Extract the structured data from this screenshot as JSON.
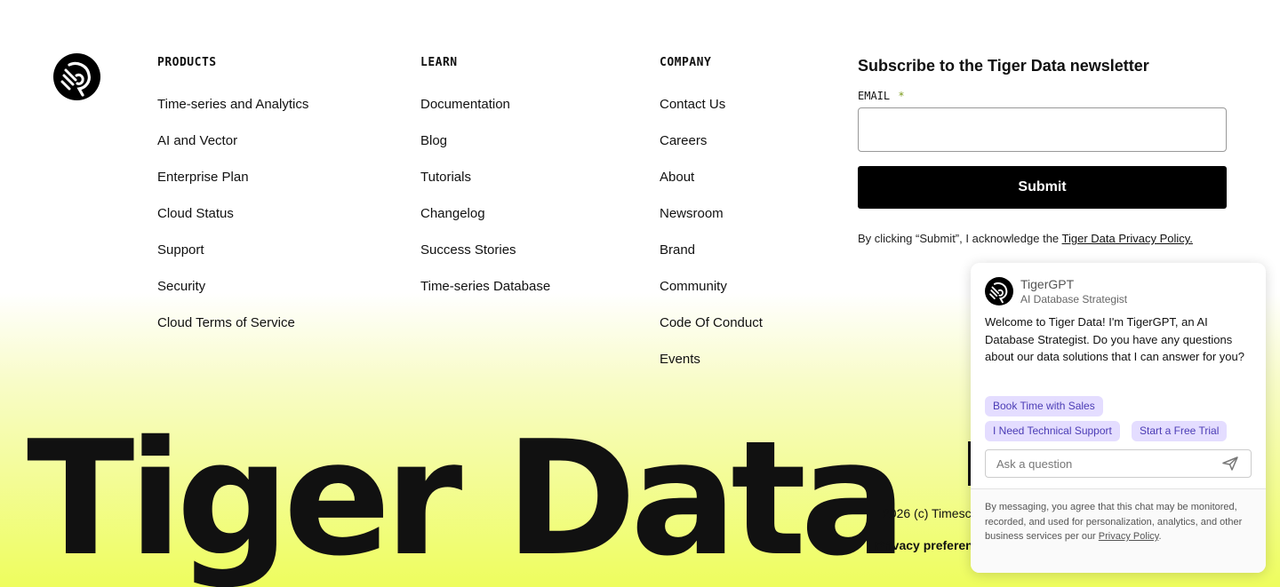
{
  "footer": {
    "columns": [
      {
        "title": "PRODUCTS",
        "items": [
          "Time-series and Analytics",
          "AI and Vector",
          "Enterprise Plan",
          "Cloud Status",
          "Support",
          "Security",
          "Cloud Terms of Service"
        ]
      },
      {
        "title": "LEARN",
        "items": [
          "Documentation",
          "Blog",
          "Tutorials",
          "Changelog",
          "Success Stories",
          "Time-series Database"
        ]
      },
      {
        "title": "COMPANY",
        "items": [
          "Contact Us",
          "Careers",
          "About",
          "Newsroom",
          "Brand",
          "Community",
          "Code Of Conduct",
          "Events"
        ]
      }
    ],
    "newsletter": {
      "title": "Subscribe to the Tiger Data newsletter",
      "email_label": "EMAIL",
      "required_mark": "*",
      "email_value": "",
      "submit_label": "Submit",
      "consent_text": "By clicking “Submit”, I acknowledge the",
      "consent_link": "Tiger Data Privacy Policy."
    },
    "wordmark": "Tiger Data",
    "copyright": "2026 (c) Timesc",
    "privacy_preferences": "Privacy preferen"
  },
  "chat": {
    "name": "TigerGPT",
    "role": "AI Database Strategist",
    "message": "Welcome to Tiger Data! I'm TigerGPT, an AI Database Strategist. Do you have any questions about our data solutions that I can answer for you?",
    "chips": [
      "Book Time with Sales",
      "I Need Technical Support",
      "Start a Free Trial"
    ],
    "input_placeholder": "Ask a question",
    "disclaimer": "By messaging, you agree that this chat may be monitored, recorded, and used for personalization, analytics, and other business services per our",
    "disclaimer_link": "Privacy Policy",
    "disclaimer_end": "."
  },
  "colors": {
    "accent_chip_bg": "#e4ddff",
    "accent_chip_text": "#4b3cb5",
    "gradient_bottom": "#eefd5e",
    "required_mark": "#7a9a1a"
  },
  "icons": {
    "brand_logo": "tiger-logo-icon",
    "chat_avatar": "tiger-logo-icon",
    "send": "send-icon"
  }
}
